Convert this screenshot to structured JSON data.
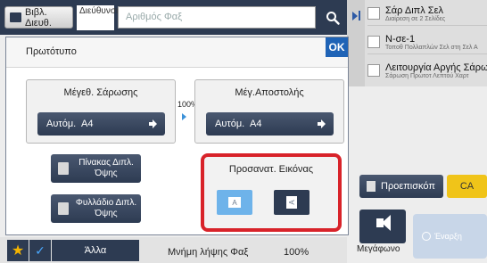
{
  "topbar": {
    "address_book_label": "Βιβλ. Διευθ.",
    "destination_label": "Διεύθυνση",
    "fax_input_placeholder": "Αριθμός Φαξ"
  },
  "jobs": [
    {
      "title": "Σάρ Διπλ Σελ",
      "subtitle": "Διαίρεση σε 2 Σελίδες"
    },
    {
      "title": "Ν-σε-1",
      "subtitle": "Τοποθ Πολλαπλών Σελ στη Σελ Α"
    },
    {
      "title": "Λειτουργία Αργής Σάρωσης",
      "subtitle": "Σάρωση Πρωτοτ Λεπτού Χαρτ"
    }
  ],
  "dialog": {
    "title": "Πρωτότυπο",
    "ok_label": "OK",
    "scan_size": {
      "title": "Μέγεθ. Σάρωσης",
      "mode": "Αυτόμ.",
      "size": "A4"
    },
    "ratio": "100%",
    "send_size": {
      "title": "Μέγ.Αποστολής",
      "mode": "Αυτόμ.",
      "size": "A4"
    },
    "table_button": "Πίνακας Διπλ. Όψης",
    "booklet_button": "Φυλλάδιο Διπλ. Όψης",
    "image_orientation": {
      "title": "Προσανατ. Εικόνας",
      "portrait_glyph": "A",
      "landscape_glyph": "A"
    }
  },
  "right_buttons": {
    "preview_label": "Προεπισκόπ",
    "ca_label": "CA",
    "speaker_label": "Μεγάφωνο",
    "send_label": "Έναρξη"
  },
  "bottombar": {
    "star_glyph": "★",
    "check_glyph": "✓",
    "other_label": "Άλλα",
    "memory_label": "Μνήμη λήψης Φαξ",
    "memory_value": "100%"
  }
}
